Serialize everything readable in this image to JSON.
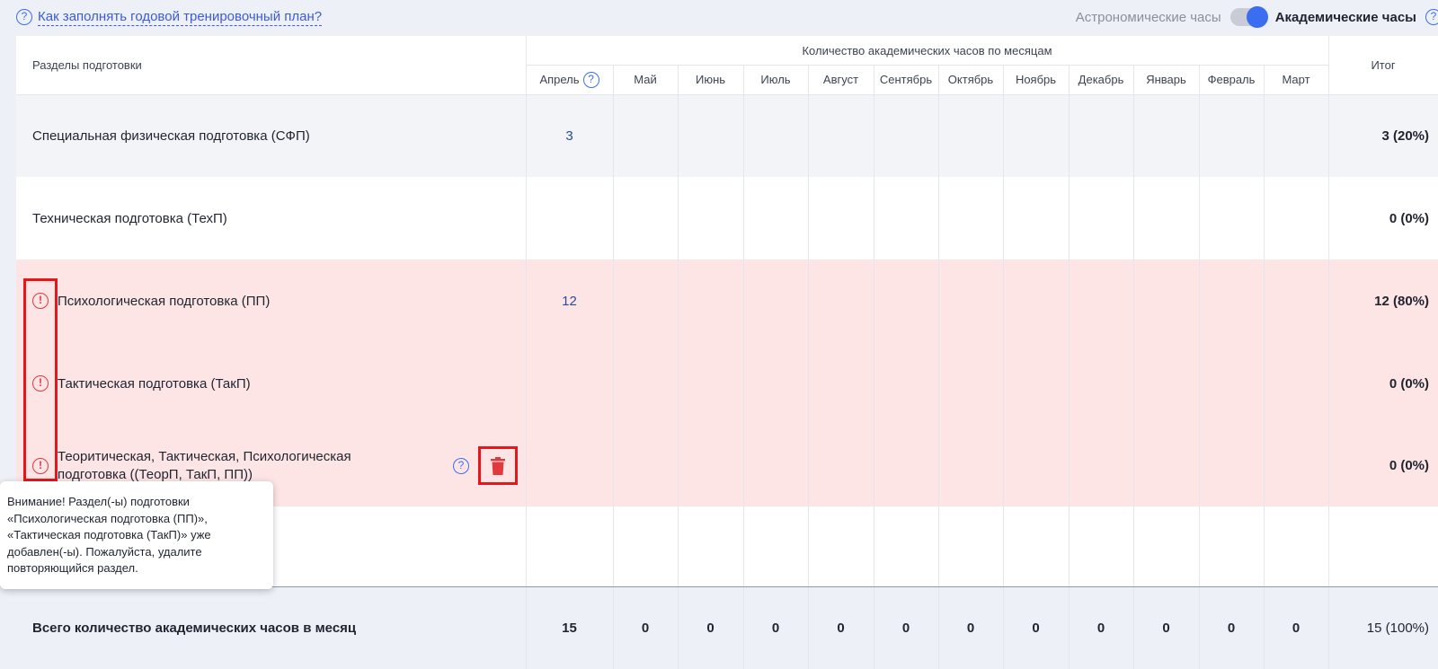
{
  "help_link": {
    "text": "Как заполнять годовой тренировочный план?"
  },
  "toggle": {
    "astro_label": "Астрономические часы",
    "acad_label": "Академические часы",
    "active": "acad"
  },
  "table": {
    "section_header": "Разделы подготовки",
    "months_header": "Количество академических часов по месяцам",
    "total_header": "Итог",
    "months": [
      "Апрель",
      "Май",
      "Июнь",
      "Июль",
      "Август",
      "Сентябрь",
      "Октябрь",
      "Ноябрь",
      "Декабрь",
      "Январь",
      "Февраль",
      "Март"
    ],
    "rows": [
      {
        "name": "Специальная физическая подготовка (СФП)",
        "values": [
          "3",
          "",
          "",
          "",
          "",
          "",
          "",
          "",
          "",
          "",
          "",
          ""
        ],
        "total": "3 (20%)",
        "warning": false
      },
      {
        "name": "Техническая подготовка (ТехП)",
        "values": [
          "",
          "",
          "",
          "",
          "",
          "",
          "",
          "",
          "",
          "",
          "",
          ""
        ],
        "total": "0 (0%)",
        "warning": false
      },
      {
        "name": "Психологическая подготовка (ПП)",
        "values": [
          "12",
          "",
          "",
          "",
          "",
          "",
          "",
          "",
          "",
          "",
          "",
          ""
        ],
        "total": "12 (80%)",
        "warning": true
      },
      {
        "name": "Тактическая подготовка (ТакП)",
        "values": [
          "",
          "",
          "",
          "",
          "",
          "",
          "",
          "",
          "",
          "",
          "",
          ""
        ],
        "total": "0 (0%)",
        "warning": true
      },
      {
        "name_line1": "Теоритическая, Тактическая, Психологическая",
        "name_line2": "подготовка ((ТеорП, ТакП, ПП))",
        "values": [
          "",
          "",
          "",
          "",
          "",
          "",
          "",
          "",
          "",
          "",
          "",
          ""
        ],
        "total": "0 (0%)",
        "warning": true
      }
    ],
    "footer": {
      "label": "Всего количество академических часов в месяц",
      "values": [
        "15",
        "0",
        "0",
        "0",
        "0",
        "0",
        "0",
        "0",
        "0",
        "0",
        "0",
        "0"
      ],
      "total": "15 (100%)"
    }
  },
  "tooltip": {
    "lines": [
      "Внимание! Раздел(-ы) подготовки",
      "«Психологическая подготовка (ПП)»,",
      "«Тактическая подготовка (ТакП)» уже",
      "добавлен(-ы). Пожалуйста, удалите",
      "повторяющийся раздел."
    ]
  },
  "colors": {
    "accent": "#3a6df0",
    "warning_row": "#fde5e6",
    "highlight": "#e8161b",
    "stripe": "#f3f4f8"
  },
  "icons": {
    "help": "question-circle-icon",
    "warning": "exclamation-circle-icon",
    "delete": "trash-icon"
  }
}
